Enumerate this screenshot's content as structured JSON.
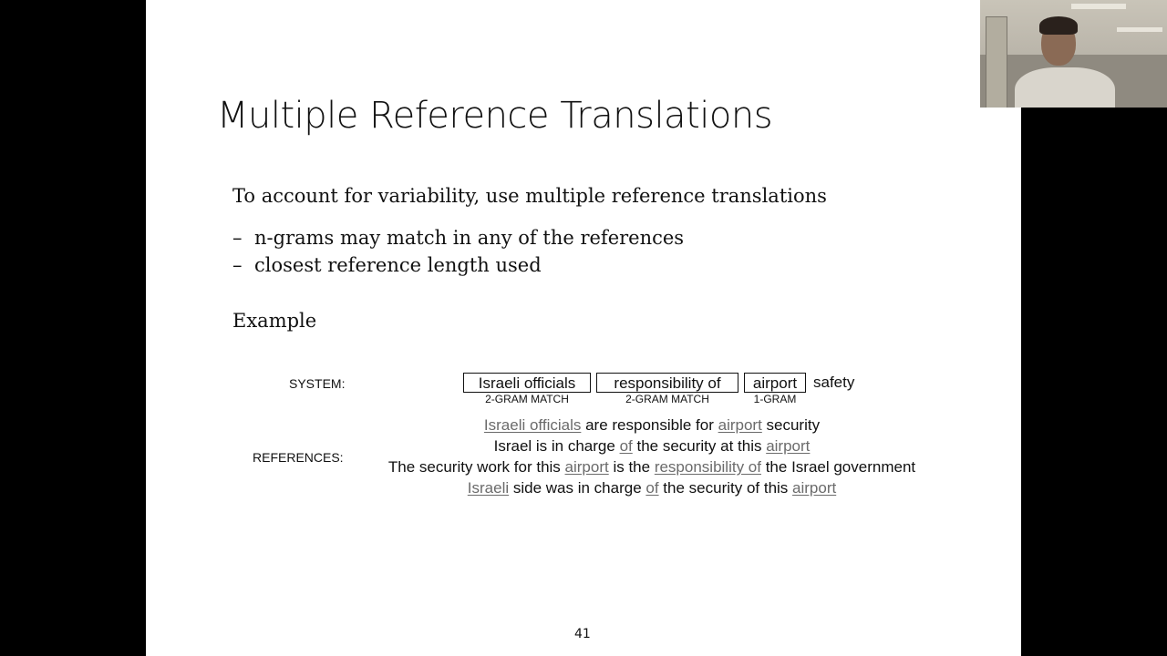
{
  "slide": {
    "title": "Multiple Reference Translations",
    "intro": "To account for variability, use multiple reference translations",
    "bullets": [
      "n-grams may match in any of the references",
      "closest reference length used"
    ],
    "bullet_marker": "–",
    "example_label": "Example",
    "page_number": "41"
  },
  "figure": {
    "system_label": "SYSTEM:",
    "references_label": "REFERENCES:",
    "system_boxes": [
      {
        "text": "Israeli officials",
        "tag": "2-GRAM MATCH"
      },
      {
        "text": "responsibility of",
        "tag": "2-GRAM MATCH"
      },
      {
        "text": "airport",
        "tag": "1-GRAM"
      }
    ],
    "system_tail": "safety",
    "references": [
      [
        {
          "text": "Israeli officials",
          "match": true
        },
        {
          "text": " are responsible for ",
          "match": false
        },
        {
          "text": "airport",
          "match": true
        },
        {
          "text": " security",
          "match": false
        }
      ],
      [
        {
          "text": "Israel is in charge ",
          "match": false
        },
        {
          "text": "of",
          "match": true
        },
        {
          "text": " the security at this ",
          "match": false
        },
        {
          "text": "airport",
          "match": true
        }
      ],
      [
        {
          "text": "The security work for this ",
          "match": false
        },
        {
          "text": "airport",
          "match": true
        },
        {
          "text": " is the ",
          "match": false
        },
        {
          "text": "responsibility of",
          "match": true
        },
        {
          "text": " the Israel government",
          "match": false
        }
      ],
      [
        {
          "text": "Israeli",
          "match": true
        },
        {
          "text": " side was in charge ",
          "match": false
        },
        {
          "text": "of",
          "match": true
        },
        {
          "text": " the security of this ",
          "match": false
        },
        {
          "text": "airport",
          "match": true
        }
      ]
    ]
  },
  "webcam": {
    "icon": "presenter-video-feed"
  },
  "colors": {
    "background": "#000000",
    "slide": "#ffffff",
    "match_text": "#6b6b6b"
  }
}
